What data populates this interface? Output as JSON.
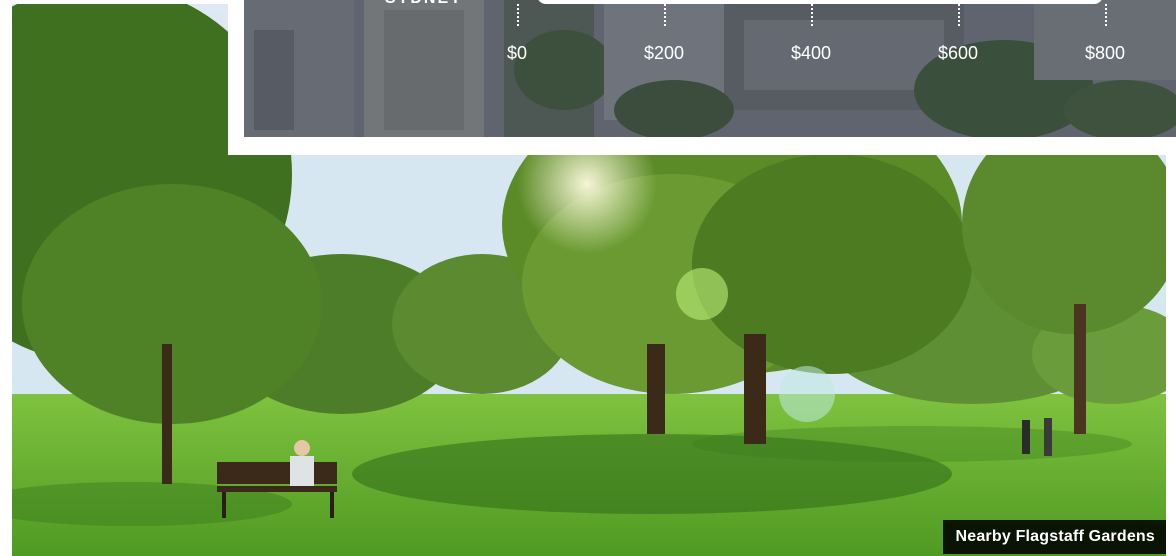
{
  "chart": {
    "city_label": "SYDNEY",
    "axis_ticks": [
      {
        "label": "$0",
        "value": 0
      },
      {
        "label": "$200",
        "value": 200
      },
      {
        "label": "$400",
        "value": 400
      },
      {
        "label": "$600",
        "value": 600
      },
      {
        "label": "$800",
        "value": 800
      }
    ]
  },
  "photo": {
    "caption": "Nearby Flagstaff Gardens"
  },
  "colors": {
    "caption_bg": "#000000",
    "track": "#ffffff",
    "grass": "#5fa02e"
  }
}
